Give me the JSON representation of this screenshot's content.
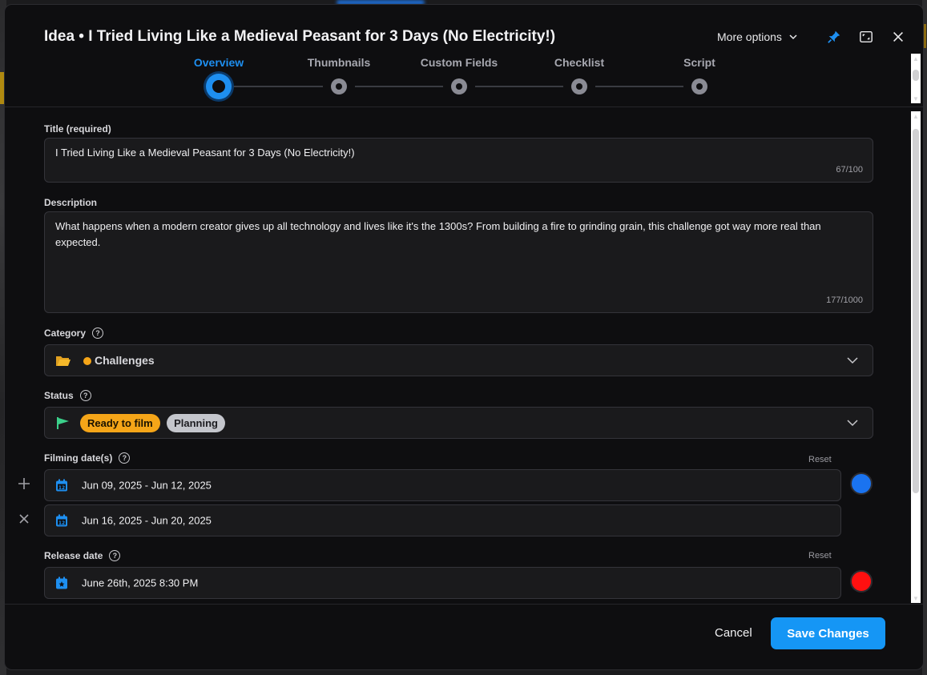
{
  "modal": {
    "title": "Idea • I Tried Living Like a Medieval Peasant for 3 Days (No Electricity!)",
    "more_options": "More options"
  },
  "steps": [
    {
      "label": "Overview",
      "active": true
    },
    {
      "label": "Thumbnails",
      "active": false
    },
    {
      "label": "Custom Fields",
      "active": false
    },
    {
      "label": "Checklist",
      "active": false
    },
    {
      "label": "Script",
      "active": false
    }
  ],
  "form": {
    "title_label": "Title (required)",
    "title_value": "I Tried Living Like a Medieval Peasant for 3 Days (No Electricity!)",
    "title_counter": "67/100",
    "description_label": "Description",
    "description_value": "What happens when a modern creator gives up all technology and lives like it's the 1300s? From building a fire to grinding grain, this challenge got way more real than expected.",
    "description_counter": "177/1000",
    "category_label": "Category",
    "category_value": "Challenges",
    "category_color": "#f5a518",
    "status_label": "Status",
    "status_badges": [
      "Ready to film",
      "Planning"
    ],
    "filming_label": "Filming date(s)",
    "filming_reset": "Reset",
    "filming_dates": [
      "Jun 09, 2025 - Jun 12, 2025",
      "Jun 16, 2025 - Jun 20, 2025"
    ],
    "filming_color": "#1a73f0",
    "release_label": "Release date",
    "release_reset": "Reset",
    "release_value": "June 26th, 2025 8:30 PM",
    "release_color": "#ff1010",
    "calendar_day": "12"
  },
  "footer": {
    "cancel_label": "Cancel",
    "save_label": "Save Changes"
  }
}
